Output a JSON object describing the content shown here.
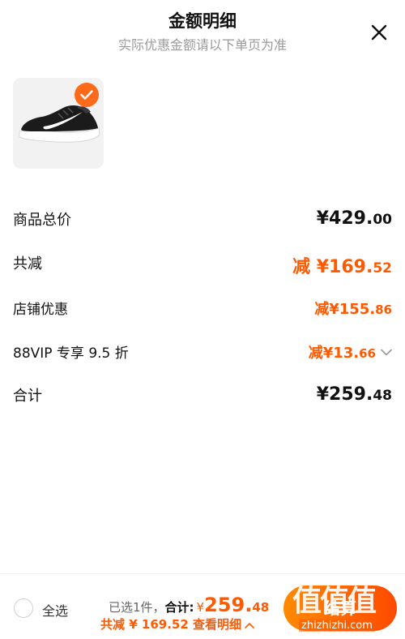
{
  "header": {
    "title": "金额明细",
    "subtitle": "实际优惠金额请以下单页为准"
  },
  "rows": {
    "goods_total": {
      "label": "商品总价",
      "value_int": "¥429.",
      "value_dec": "00"
    },
    "total_discount": {
      "label": "共减",
      "prefix": "减 ",
      "value_int": "¥169.",
      "value_dec": "52"
    },
    "store_discount": {
      "label": "店铺优惠",
      "prefix": "减",
      "value_int": "¥155.",
      "value_dec": "86"
    },
    "vip_discount": {
      "label": "88VIP 专享 9.5 折",
      "prefix": "减",
      "value_int": "¥13.",
      "value_dec": "66"
    },
    "sum": {
      "label": "合计",
      "value_int": "¥259.",
      "value_dec": "48"
    }
  },
  "bottom_bar": {
    "select_all": "全选",
    "selected_text": "已选1件，",
    "total_label": "合计:",
    "total_yen": "¥",
    "total_int": "259.",
    "total_dec": "48",
    "discount_text": "共减 ¥ 169.52",
    "detail_link": "查看明细",
    "checkout_label": "结算"
  },
  "watermark": {
    "big": "值值值",
    "url": "zhizhizhi.com"
  },
  "colors": {
    "accent": "#ff5a00",
    "badge": "#ff6a1a"
  },
  "icons": {
    "close": "close-icon",
    "check": "check-icon",
    "chevron": "chevron-down-icon",
    "caret": "caret-up-icon"
  }
}
